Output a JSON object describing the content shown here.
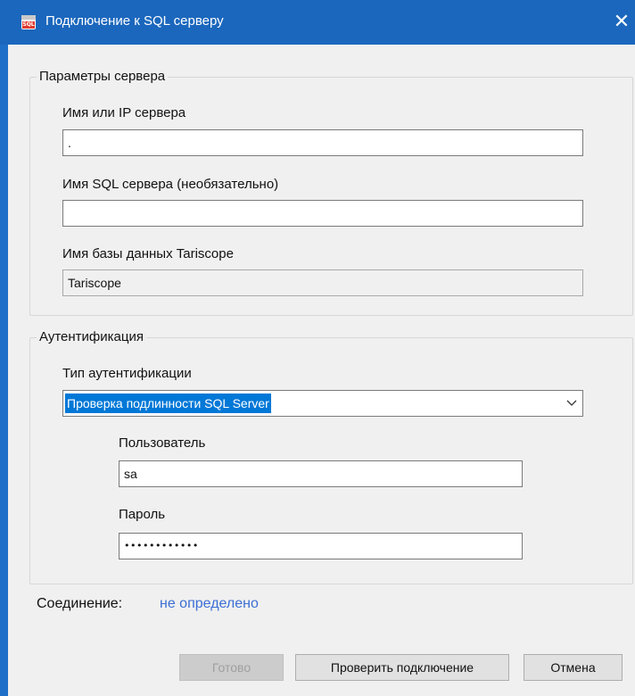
{
  "window": {
    "title": "Подключение к SQL серверу",
    "icon": "sql-database-icon",
    "close_glyph": "✕"
  },
  "server_group": {
    "title": "Параметры сервера",
    "host_label": "Имя или IP сервера",
    "host_value": ".",
    "instance_label": "Имя SQL сервера (необязательно)",
    "instance_value": "",
    "db_label": "Имя базы данных Tariscope",
    "db_value": "Tariscope"
  },
  "auth_group": {
    "title": "Аутентификация",
    "type_label": "Тип аутентификации",
    "type_value": "Проверка подлинности SQL Server",
    "user_label": "Пользователь",
    "user_value": "sa",
    "password_label": "Пароль",
    "password_value": "••••••••••••"
  },
  "connection": {
    "label": "Соединение:",
    "status": "не определено",
    "status_color": "#3c6fd4"
  },
  "buttons": {
    "done": "Готово",
    "test": "Проверить подключение",
    "cancel": "Отмена"
  },
  "colors": {
    "titlebar": "#1b67bd",
    "selection": "#0078d7"
  }
}
